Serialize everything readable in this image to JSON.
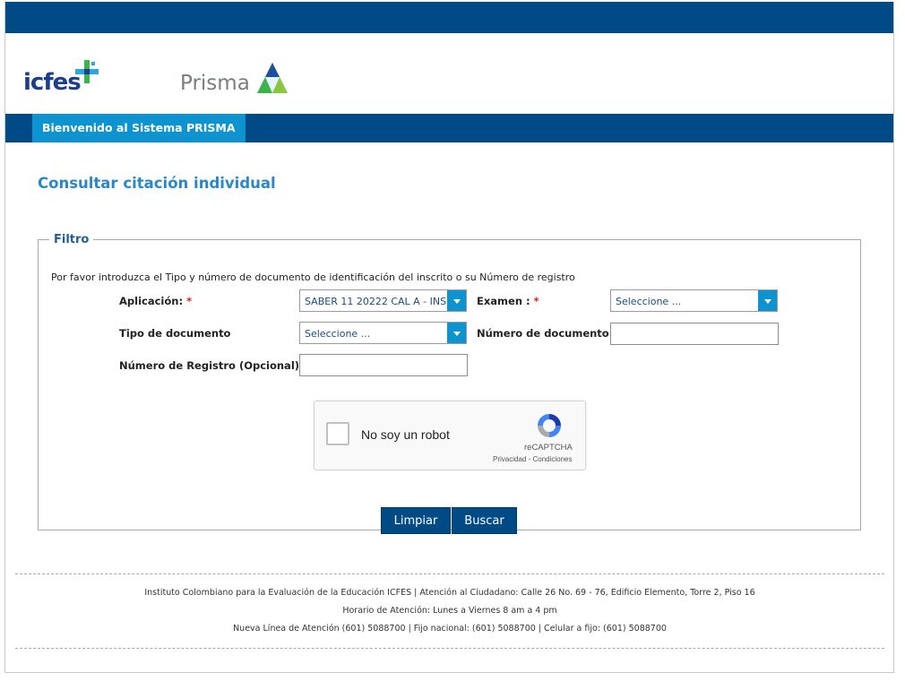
{
  "brand": {
    "icfes_logo_text": "icfes",
    "prisma_logo_text": "Prisma"
  },
  "nav": {
    "welcome_tab": "Bienvenido al Sistema PRISMA"
  },
  "page": {
    "title": "Consultar citación individual"
  },
  "filter": {
    "legend": "Filtro",
    "instructions": "Por favor introduzca el Tipo y número de documento de identificación del inscrito o su Número de registro",
    "aplicacion_label": "Aplicación:",
    "aplicacion_value": "SABER 11 20222 CAL A - INS",
    "examen_label": "Examen :",
    "examen_value": "Seleccione ...",
    "required_mark": "*",
    "tipo_documento_label": "Tipo de documento",
    "tipo_documento_value": "Seleccione ...",
    "numero_documento_label": "Número de documento",
    "numero_documento_value": "",
    "numero_registro_label": "Número de Registro (Opcional)",
    "numero_registro_value": ""
  },
  "captcha": {
    "checkbox_label": "No soy un robot",
    "brand": "reCAPTCHA",
    "terms": "Privacidad - Condiciones"
  },
  "actions": {
    "clear_label": "Limpiar",
    "search_label": "Buscar"
  },
  "footer": {
    "line1": "Instituto Colombiano para la Evaluación de la Educación ICFES  |   Atención al Ciudadano: Calle 26 No. 69 - 76, Edificio Elemento, Torre 2, Piso 16",
    "line2": "Horario de Atención: Lunes a Viernes 8 am a 4 pm",
    "line3": "Nueva Línea de Atención (601) 5088700  |  Fijo nacional: (601) 5088700  |  Celular a fijo: (601) 5088700"
  },
  "colors": {
    "header_blue": "#004b85",
    "tab_blue": "#0d93cf",
    "title_blue": "#2b88c8",
    "required_red": "#d9211f"
  }
}
